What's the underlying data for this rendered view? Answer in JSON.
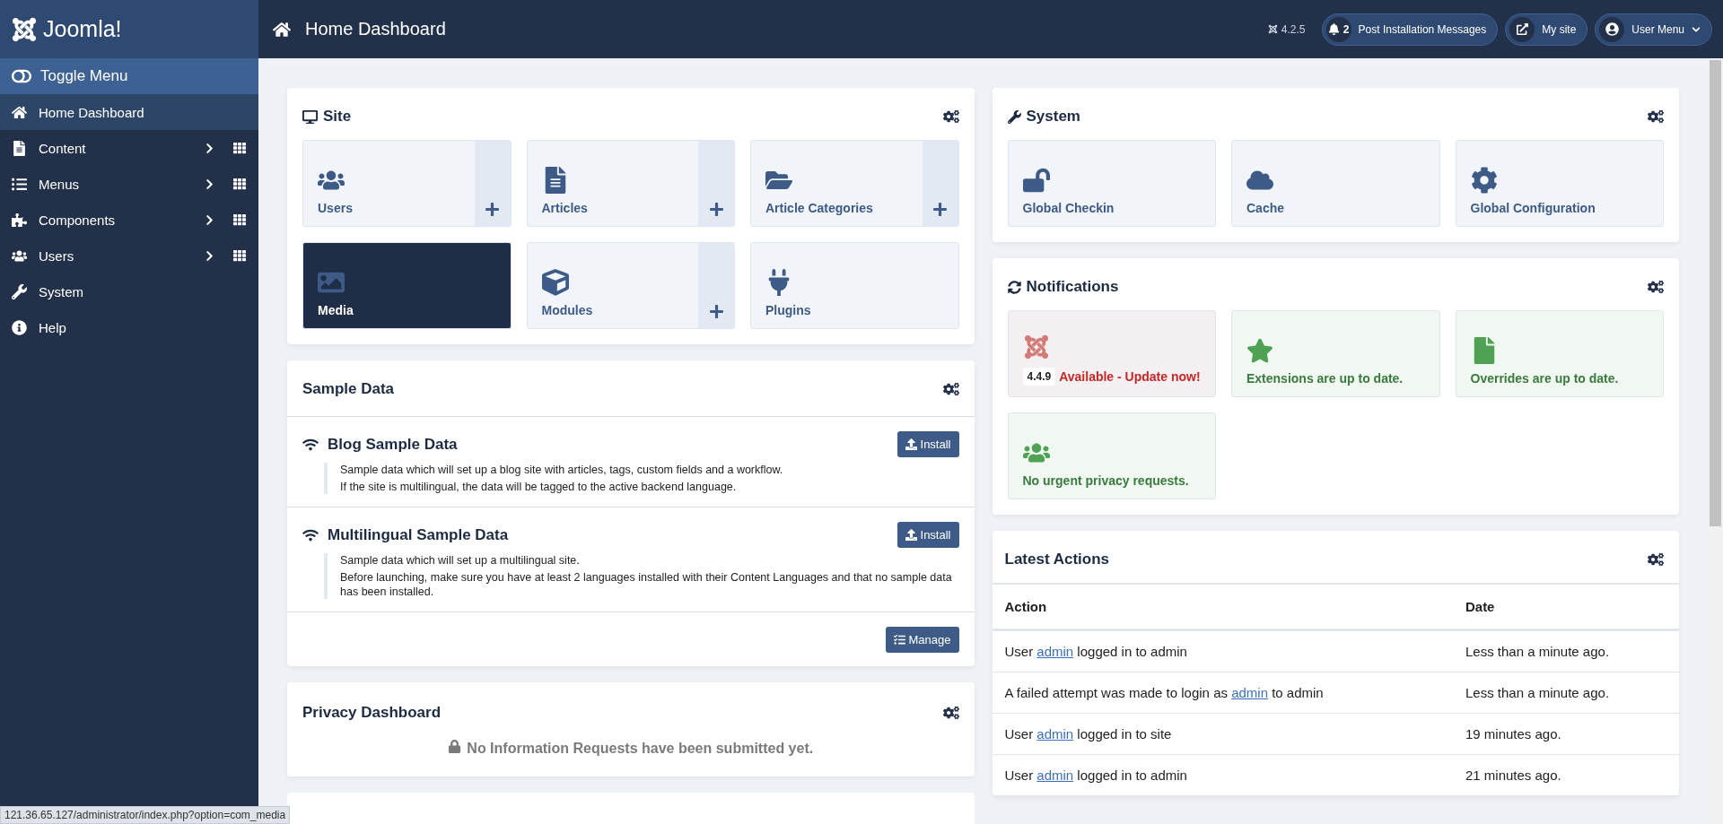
{
  "brand": {
    "name": "Joomla!"
  },
  "header": {
    "title": "Home Dashboard",
    "version": "4.2.5",
    "buttons": [
      {
        "kind": "messages",
        "count": "2",
        "label": "Post Installation Messages"
      },
      {
        "kind": "site",
        "label": "My site"
      },
      {
        "kind": "user",
        "label": "User Menu"
      }
    ]
  },
  "sidebar": {
    "toggle": "Toggle Menu",
    "items": [
      {
        "label": "Home Dashboard",
        "selected": true,
        "submenu": false
      },
      {
        "label": "Content",
        "selected": false,
        "submenu": true
      },
      {
        "label": "Menus",
        "selected": false,
        "submenu": true
      },
      {
        "label": "Components",
        "selected": false,
        "submenu": true
      },
      {
        "label": "Users",
        "selected": false,
        "submenu": true
      },
      {
        "label": "System",
        "selected": false,
        "submenu": false
      },
      {
        "label": "Help",
        "selected": false,
        "submenu": false
      }
    ]
  },
  "site": {
    "title": "Site",
    "tiles": [
      {
        "label": "Users",
        "selected": false,
        "add": true
      },
      {
        "label": "Articles",
        "selected": false,
        "add": true
      },
      {
        "label": "Article Categories",
        "selected": false,
        "add": true
      },
      {
        "label": "Media",
        "selected": true,
        "add": false
      },
      {
        "label": "Modules",
        "selected": false,
        "add": true
      },
      {
        "label": "Plugins",
        "selected": false,
        "add": false
      }
    ]
  },
  "sample_data": {
    "title": "Sample Data",
    "items": [
      {
        "title": "Blog Sample Data",
        "button": "Install",
        "lines": [
          "Sample data which will set up a blog site with articles, tags, custom fields and a workflow.",
          "If the site is multilingual, the data will be tagged to the active backend language."
        ]
      },
      {
        "title": "Multilingual Sample Data",
        "button": "Install",
        "lines": [
          "Sample data which will set up a multilingual site.",
          "Before launching, make sure you have at least 2 languages installed with their Content Languages and that no sample data has been installed."
        ]
      }
    ],
    "manage": "Manage"
  },
  "privacy": {
    "title": "Privacy Dashboard",
    "message": "No Information Requests have been submitted yet."
  },
  "system": {
    "title": "System",
    "tiles": [
      {
        "label": "Global Checkin"
      },
      {
        "label": "Cache"
      },
      {
        "label": "Global Configuration"
      }
    ]
  },
  "notifications": {
    "title": "Notifications",
    "tiles": [
      {
        "kind": "danger",
        "badge": "4.4.9",
        "label": "Available - Update now!"
      },
      {
        "kind": "success",
        "label": "Extensions are up to date."
      },
      {
        "kind": "success",
        "label": "Overrides are up to date."
      },
      {
        "kind": "success",
        "label": "No urgent privacy requests."
      }
    ]
  },
  "latest_actions": {
    "title": "Latest Actions",
    "columns": [
      "Action",
      "Date"
    ],
    "rows": [
      {
        "before": "User ",
        "link": "admin",
        "after": " logged in to admin",
        "date": "Less than a minute ago."
      },
      {
        "before": "A failed attempt was made to login as ",
        "link": "admin",
        "after": " to admin",
        "date": "Less than a minute ago."
      },
      {
        "before": "User ",
        "link": "admin",
        "after": " logged in to site",
        "date": "19 minutes ago."
      },
      {
        "before": "User ",
        "link": "admin",
        "after": " logged in to admin",
        "date": "21 minutes ago."
      }
    ]
  },
  "status_bar": {
    "url": "121.36.65.127/administrator/index.php?option=com_media"
  }
}
